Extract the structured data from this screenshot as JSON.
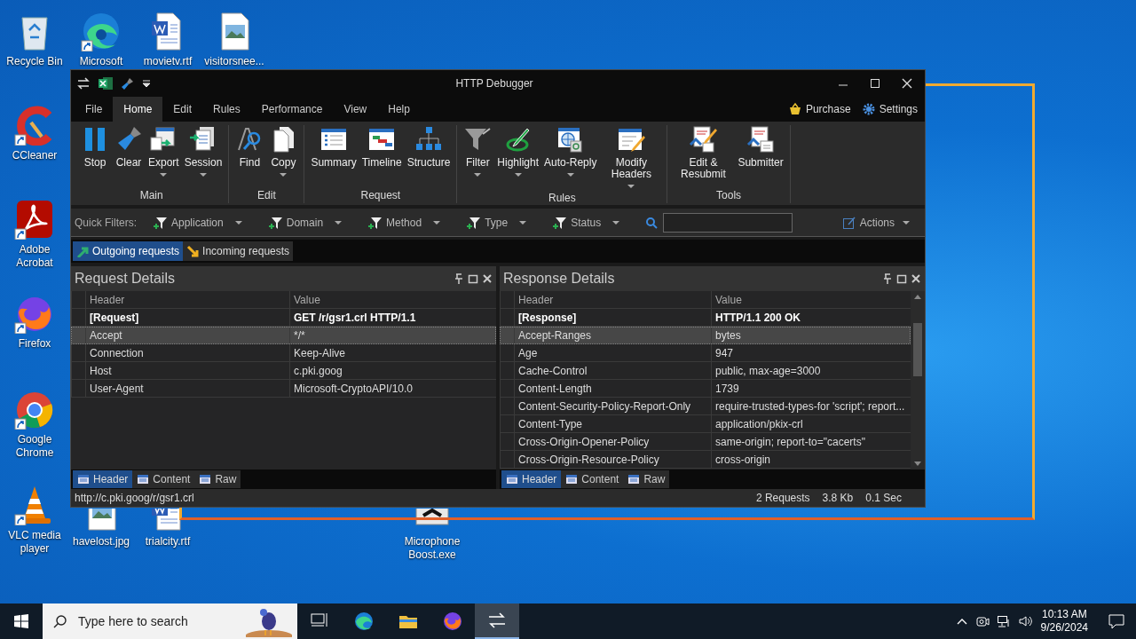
{
  "desktop": {
    "icons": [
      {
        "label": "Recycle Bin",
        "kind": "recycle",
        "shortcut": false
      },
      {
        "label": "Microsoft",
        "kind": "edge",
        "shortcut": true
      },
      {
        "label": "movietv.rtf",
        "kind": "word",
        "shortcut": false
      },
      {
        "label": "visitorsnee...",
        "kind": "image",
        "shortcut": false
      },
      {
        "label": "CCleaner",
        "kind": "ccleaner",
        "shortcut": true
      },
      {
        "label": "Adobe Acrobat",
        "kind": "acrobat",
        "shortcut": true
      },
      {
        "label": "Firefox",
        "kind": "firefox",
        "shortcut": true
      },
      {
        "label": "Google Chrome",
        "kind": "chrome",
        "shortcut": true
      },
      {
        "label": "VLC media player",
        "kind": "vlc",
        "shortcut": true
      },
      {
        "label": "havelost.jpg",
        "kind": "image",
        "shortcut": false
      },
      {
        "label": "trialcity.rtf",
        "kind": "word",
        "shortcut": false
      },
      {
        "label": "Microphone Boost.exe",
        "kind": "exe",
        "shortcut": false
      }
    ]
  },
  "window": {
    "title": "HTTP Debugger",
    "menu": [
      {
        "label": "File",
        "selected": false
      },
      {
        "label": "Home",
        "selected": true
      },
      {
        "label": "Edit",
        "selected": false
      },
      {
        "label": "Rules",
        "selected": false
      },
      {
        "label": "Performance",
        "selected": false
      },
      {
        "label": "View",
        "selected": false
      },
      {
        "label": "Help",
        "selected": false
      }
    ],
    "menu_links": [
      "Purchase",
      "Settings"
    ],
    "ribbon": {
      "groups": [
        {
          "label": "Main",
          "buttons": [
            {
              "label": "Stop",
              "dropdown": false
            },
            {
              "label": "Clear",
              "dropdown": false
            },
            {
              "label": "Export",
              "dropdown": true
            },
            {
              "label": "Session",
              "dropdown": true
            }
          ]
        },
        {
          "label": "Edit",
          "buttons": [
            {
              "label": "Find",
              "dropdown": false
            },
            {
              "label": "Copy",
              "dropdown": true
            }
          ]
        },
        {
          "label": "Request",
          "buttons": [
            {
              "label": "Summary",
              "dropdown": false
            },
            {
              "label": "Timeline",
              "dropdown": false
            },
            {
              "label": "Structure",
              "dropdown": false
            }
          ]
        },
        {
          "label": "Rules",
          "buttons": [
            {
              "label": "Filter",
              "dropdown": true
            },
            {
              "label": "Highlight",
              "dropdown": true
            },
            {
              "label": "Auto-Reply",
              "dropdown": true
            },
            {
              "label": "Modify Headers",
              "dropdown": true
            }
          ]
        },
        {
          "label": "Tools",
          "buttons": [
            {
              "label": "Edit & Resubmit",
              "dropdown": false
            },
            {
              "label": "Submitter",
              "dropdown": false
            }
          ]
        }
      ]
    },
    "quick_filters": {
      "label": "Quick Filters:",
      "filters": [
        "Application",
        "Domain",
        "Method",
        "Type",
        "Status"
      ],
      "actions": "Actions"
    },
    "request_tabs": [
      {
        "label": "Outgoing requests",
        "selected": true
      },
      {
        "label": "Incoming requests",
        "selected": false
      }
    ],
    "panels": [
      {
        "title": "Request Details",
        "columns": [
          "Header",
          "Value"
        ],
        "rows": [
          {
            "header": "[Request]",
            "value": "GET /r/gsr1.crl HTTP/1.1",
            "kind": "start",
            "selected": false
          },
          {
            "header": "Accept",
            "value": "*/*",
            "kind": "field",
            "selected": true
          },
          {
            "header": "Connection",
            "value": "Keep-Alive",
            "kind": "field",
            "selected": false
          },
          {
            "header": "Host",
            "value": "c.pki.goog",
            "kind": "field",
            "selected": false
          },
          {
            "header": "User-Agent",
            "value": "Microsoft-CryptoAPI/10.0",
            "kind": "field",
            "selected": false
          }
        ],
        "tabs": [
          {
            "label": "Header",
            "selected": true
          },
          {
            "label": "Content",
            "selected": false
          },
          {
            "label": "Raw",
            "selected": false
          }
        ]
      },
      {
        "title": "Response Details",
        "columns": [
          "Header",
          "Value"
        ],
        "rows": [
          {
            "header": "[Response]",
            "value": "HTTP/1.1 200 OK",
            "kind": "start",
            "selected": false
          },
          {
            "header": "Accept-Ranges",
            "value": "bytes",
            "kind": "field",
            "selected": true
          },
          {
            "header": "Age",
            "value": "947",
            "kind": "field",
            "selected": false
          },
          {
            "header": "Cache-Control",
            "value": "public, max-age=3000",
            "kind": "field",
            "selected": false
          },
          {
            "header": "Content-Length",
            "value": "1739",
            "kind": "field",
            "selected": false
          },
          {
            "header": "Content-Security-Policy-Report-Only",
            "value": "require-trusted-types-for 'script'; report...",
            "kind": "field",
            "selected": false
          },
          {
            "header": "Content-Type",
            "value": "application/pkix-crl",
            "kind": "field",
            "selected": false
          },
          {
            "header": "Cross-Origin-Opener-Policy",
            "value": "same-origin; report-to=\"cacerts\"",
            "kind": "field",
            "selected": false
          },
          {
            "header": "Cross-Origin-Resource-Policy",
            "value": "cross-origin",
            "kind": "field",
            "selected": false
          }
        ],
        "tabs": [
          {
            "label": "Header",
            "selected": true
          },
          {
            "label": "Content",
            "selected": false
          },
          {
            "label": "Raw",
            "selected": false
          }
        ]
      }
    ],
    "status_bar": {
      "url": "http://c.pki.goog/r/gsr1.crl",
      "requests": "2 Requests",
      "size": "3.8 Kb",
      "time": "0.1 Sec"
    }
  },
  "taskbar": {
    "search_placeholder": "Type here to search",
    "apps": [
      {
        "kind": "taskview",
        "active": false
      },
      {
        "kind": "edge",
        "active": false
      },
      {
        "kind": "explorer",
        "active": false
      },
      {
        "kind": "firefox",
        "active": false
      },
      {
        "kind": "debugger",
        "active": true
      }
    ],
    "time": "10:13 AM",
    "date": "9/26/2024"
  }
}
